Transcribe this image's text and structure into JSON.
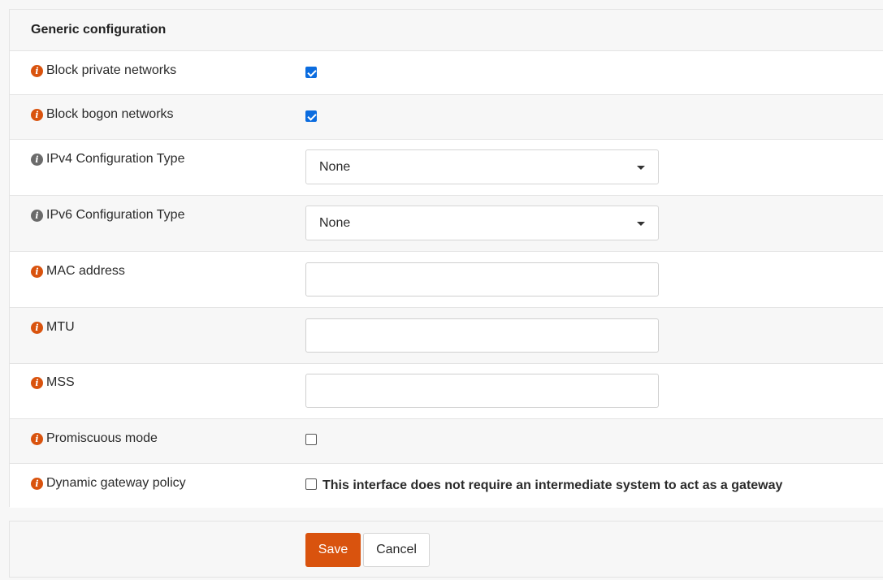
{
  "section": {
    "title": "Generic configuration"
  },
  "fields": {
    "block_private": {
      "label": "Block private networks",
      "checked": true
    },
    "block_bogon": {
      "label": "Block bogon networks",
      "checked": true
    },
    "ipv4_type": {
      "label": "IPv4 Configuration Type",
      "value": "None"
    },
    "ipv6_type": {
      "label": "IPv6 Configuration Type",
      "value": "None"
    },
    "mac": {
      "label": "MAC address",
      "value": ""
    },
    "mtu": {
      "label": "MTU",
      "value": ""
    },
    "mss": {
      "label": "MSS",
      "value": ""
    },
    "promisc": {
      "label": "Promiscuous mode",
      "checked": false
    },
    "dyn_gw": {
      "label": "Dynamic gateway policy",
      "checkbox_text": "This interface does not require an intermediate system to act as a gateway",
      "checked": false
    }
  },
  "info_glyph": "i",
  "buttons": {
    "save": "Save",
    "cancel": "Cancel"
  },
  "colors": {
    "accent": "#d9530e",
    "check": "#0b6cdf",
    "info_grey": "#6b6b6b"
  }
}
